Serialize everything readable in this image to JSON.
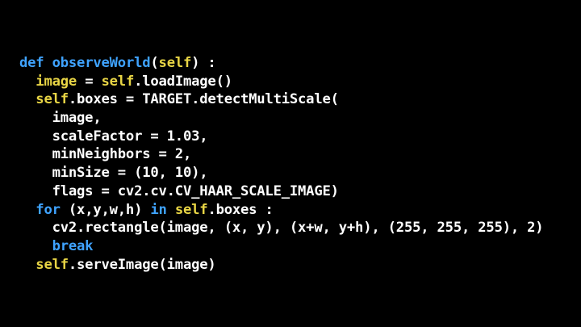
{
  "colors": {
    "background": "#000000",
    "keyword": "#3fa3ff",
    "self": "#e8d545",
    "text": "#ffffff"
  },
  "code": {
    "lines": [
      [
        {
          "t": "def",
          "c": "kw"
        },
        {
          "t": " ",
          "c": "plain"
        },
        {
          "t": "observeWorld",
          "c": "fn"
        },
        {
          "t": "(",
          "c": "plain"
        },
        {
          "t": "self",
          "c": "sf"
        },
        {
          "t": ") :",
          "c": "plain"
        }
      ],
      [
        {
          "t": "  ",
          "c": "plain"
        },
        {
          "t": "image",
          "c": "sf"
        },
        {
          "t": " = ",
          "c": "plain"
        },
        {
          "t": "self",
          "c": "sf"
        },
        {
          "t": ".loadImage()",
          "c": "plain"
        }
      ],
      [
        {
          "t": "  ",
          "c": "plain"
        },
        {
          "t": "self",
          "c": "sf"
        },
        {
          "t": ".boxes = TARGET.detectMultiScale(",
          "c": "plain"
        }
      ],
      [
        {
          "t": "    image,",
          "c": "plain"
        }
      ],
      [
        {
          "t": "    scaleFactor = 1.03,",
          "c": "plain"
        }
      ],
      [
        {
          "t": "    minNeighbors = 2,",
          "c": "plain"
        }
      ],
      [
        {
          "t": "    minSize = (10, 10),",
          "c": "plain"
        }
      ],
      [
        {
          "t": "    flags = cv2.cv.CV_HAAR_SCALE_IMAGE)",
          "c": "plain"
        }
      ],
      [
        {
          "t": "  ",
          "c": "plain"
        },
        {
          "t": "for",
          "c": "kw"
        },
        {
          "t": " (x,y,w,h) ",
          "c": "plain"
        },
        {
          "t": "in",
          "c": "kw"
        },
        {
          "t": " ",
          "c": "plain"
        },
        {
          "t": "self",
          "c": "sf"
        },
        {
          "t": ".boxes :",
          "c": "plain"
        }
      ],
      [
        {
          "t": "    cv2.rectangle(image, (x, y), (x+w, y+h), (255, 255, 255), 2)",
          "c": "plain"
        }
      ],
      [
        {
          "t": "    ",
          "c": "plain"
        },
        {
          "t": "break",
          "c": "kw"
        }
      ],
      [
        {
          "t": "  ",
          "c": "plain"
        },
        {
          "t": "self",
          "c": "sf"
        },
        {
          "t": ".serveImage(image)",
          "c": "plain"
        }
      ]
    ]
  }
}
